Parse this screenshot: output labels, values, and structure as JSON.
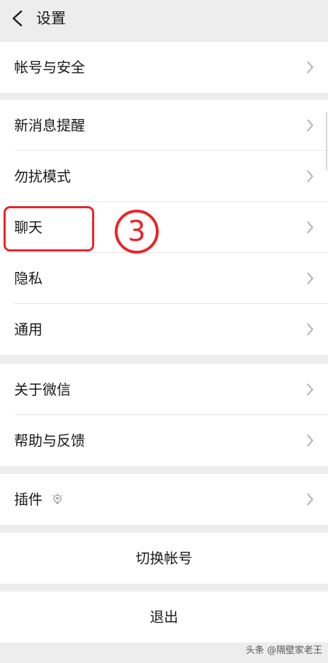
{
  "header": {
    "title": "设置",
    "back_icon": "chevron-left-icon"
  },
  "groups": [
    {
      "items": [
        {
          "label": "帐号与安全"
        }
      ]
    },
    {
      "items": [
        {
          "label": "新消息提醒"
        },
        {
          "label": "勿扰模式"
        },
        {
          "label": "聊天"
        },
        {
          "label": "隐私"
        },
        {
          "label": "通用"
        }
      ]
    },
    {
      "items": [
        {
          "label": "关于微信"
        },
        {
          "label": "帮助与反馈"
        }
      ]
    },
    {
      "items": [
        {
          "label": "插件",
          "icon": "bulb-icon"
        }
      ]
    }
  ],
  "actions": {
    "switch_account": "切换帐号",
    "logout": "退出"
  },
  "annotation": {
    "number": "3",
    "color": "#e8242a"
  },
  "watermark": "头条 @隔壁家老王"
}
